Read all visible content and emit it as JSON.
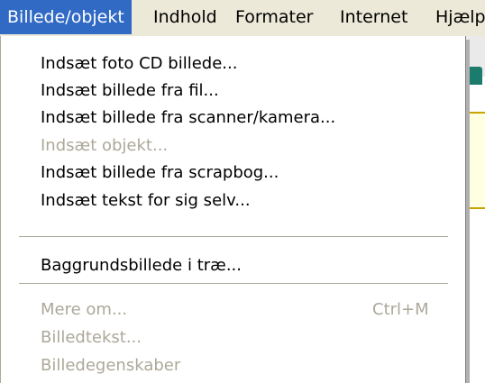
{
  "menubar": {
    "items": [
      {
        "label": "Billede/objekt"
      },
      {
        "label": "Indhold"
      },
      {
        "label": "Formater"
      },
      {
        "label": "Internet"
      },
      {
        "label": "Hjælp"
      }
    ]
  },
  "menu": {
    "items": [
      {
        "label": "Indsæt foto CD billede...",
        "enabled": true
      },
      {
        "label": "Indsæt billede fra fil...",
        "enabled": true
      },
      {
        "label": "Indsæt billede fra scanner/kamera...",
        "enabled": true
      },
      {
        "label": "Indsæt objekt...",
        "enabled": false
      },
      {
        "label": "Indsæt billede fra scrapbog...",
        "enabled": true
      },
      {
        "label": "Indsæt tekst for sig selv...",
        "enabled": true
      },
      {
        "label": "Baggrundsbillede i træ...",
        "enabled": true
      },
      {
        "label": "Mere om...",
        "enabled": false,
        "shortcut": "Ctrl+M"
      },
      {
        "label": "Billedtekst...",
        "enabled": false
      },
      {
        "label": "Billedegenskaber",
        "enabled": false
      }
    ]
  }
}
